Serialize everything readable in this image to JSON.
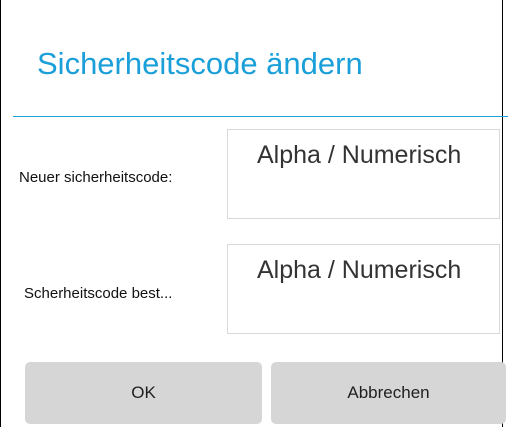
{
  "dialog": {
    "title": "Sicherheitscode ändern",
    "accent_color": "#1a9fd9"
  },
  "fields": [
    {
      "label": "Neuer sicherheitscode:",
      "placeholder": "Alpha / Numerisch"
    },
    {
      "label": "Scherheitscode best...",
      "placeholder": "Alpha / Numerisch"
    }
  ],
  "buttons": {
    "ok_label": "OK",
    "cancel_label": "Abbrechen",
    "background_color": "#d6d6d6"
  }
}
